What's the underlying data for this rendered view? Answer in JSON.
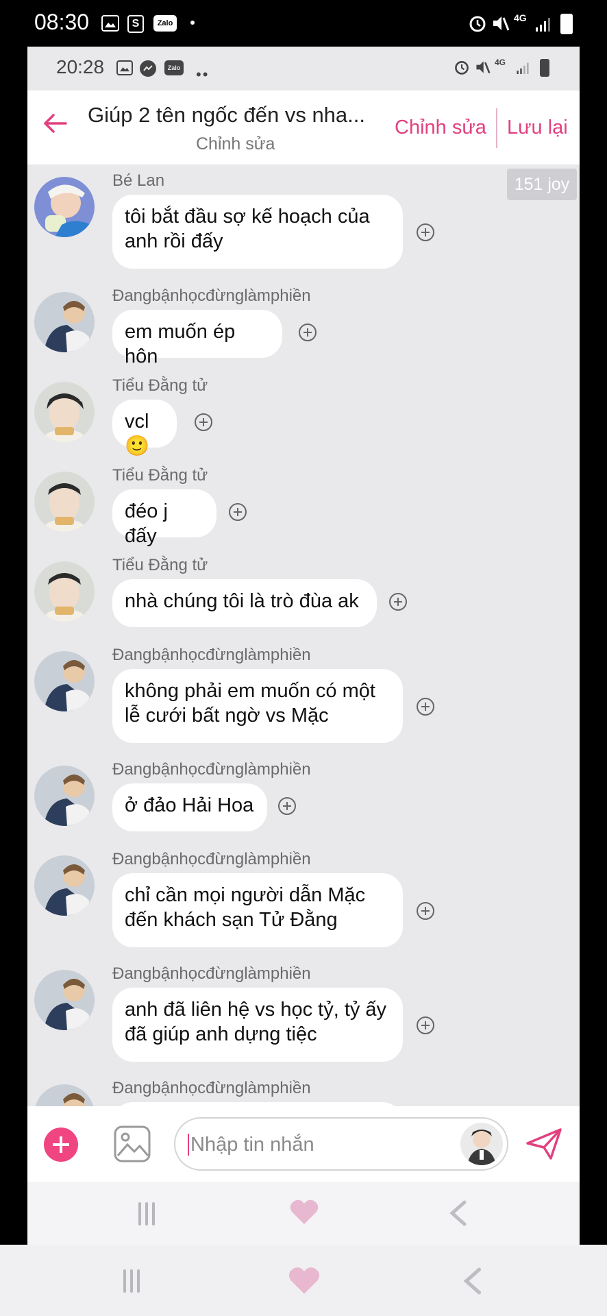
{
  "outer_status": {
    "time": "08:30",
    "network": "4G",
    "icons": [
      "gallery-icon",
      "shop-icon",
      "zalo-icon",
      "dot-icon",
      "alarm-icon",
      "mute-icon",
      "signal-icon",
      "battery-icon"
    ],
    "zalo_text": "Zalo"
  },
  "inner_status": {
    "time": "20:28",
    "network": "4G",
    "zalo_text": "Zalo"
  },
  "header": {
    "title": "Giúp 2 tên ngốc đến vs nha...",
    "subtitle": "Chỉnh sửa",
    "edit_label": "Chỉnh sửa",
    "save_label": "Lưu lại"
  },
  "joy_badge": "151 joy",
  "messages": [
    {
      "sender": "Bé Lan",
      "text": "tôi bắt đầu sợ kế hoạch của anh rồi đấy"
    },
    {
      "sender": "Đangbậnhọcđừnglàmphiền",
      "text": "em muốn ép hôn"
    },
    {
      "sender": "Tiểu Đằng tử",
      "text": "vcl",
      "emoji": "🙂"
    },
    {
      "sender": "Tiểu Đằng tử",
      "text": "đéo j đấy"
    },
    {
      "sender": "Tiểu Đằng tử",
      "text": "nhà chúng tôi là trò đùa ak"
    },
    {
      "sender": "Đangbậnhọcđừnglàmphiền",
      "text": "không phải em muốn có một lễ cưới bất ngờ vs Mặc"
    },
    {
      "sender": "Đangbậnhọcđừnglàmphiền",
      "text": "ở đảo Hải Hoa"
    },
    {
      "sender": "Đangbậnhọcđừnglàmphiền",
      "text": "chỉ cần mọi người dẫn Mặc đến khách sạn Tử Đằng"
    },
    {
      "sender": "Đangbậnhọcđừnglàmphiền",
      "text": "anh đã liên hệ vs học tỷ, tỷ ấy đã giúp anh dựng tiệc"
    },
    {
      "sender": "Đangbậnhọcđừnglàmphiền",
      "text": ""
    }
  ],
  "composer": {
    "placeholder": "Nhập tin nhắn"
  },
  "colors": {
    "accent": "#e2407f",
    "plus_button": "#f04581",
    "bubble": "#ffffff",
    "background": "#e9e9ec"
  }
}
